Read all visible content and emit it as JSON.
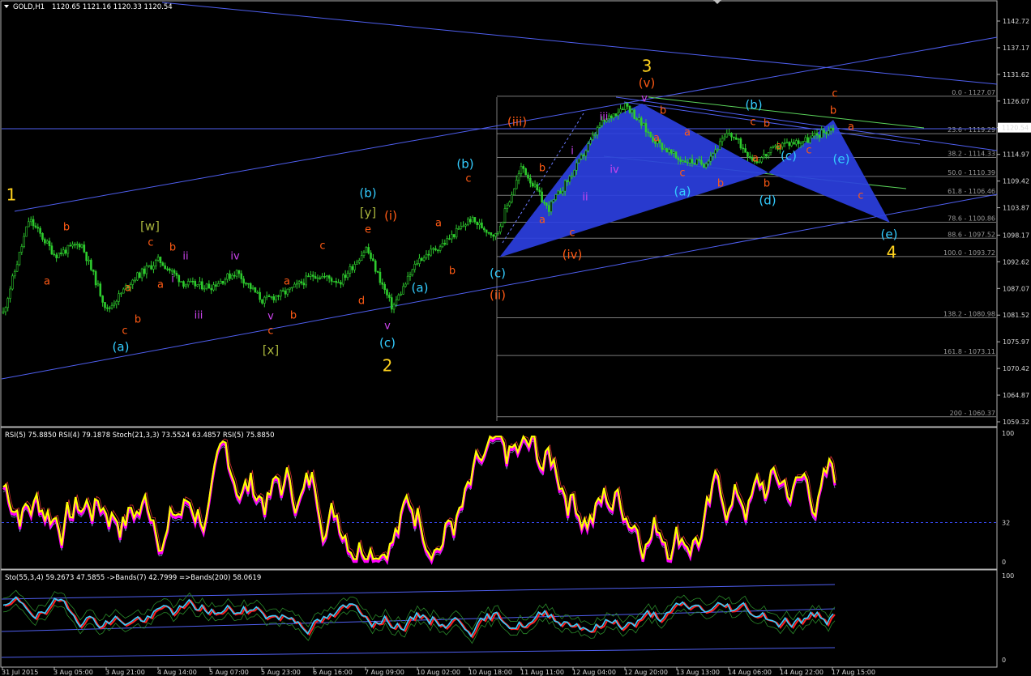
{
  "header": {
    "symbol": "GOLD,H1",
    "ohlc": "1120.65 1121.16 1120.33 1120.54",
    "rsi_header": "RSI(5) 75.8850  RSI(4) 79.1878  Stoch(21,3,3) 73.5524 63.4857  RSI(5) 75.8850",
    "sto_header": "Sto(55,3,4) 59.2673 47.5855  ->Bands(7) 42.7999  =>Bands(200) 58.0619"
  },
  "price_axis": {
    "ticks": [
      "1142.72",
      "1137.17",
      "1131.62",
      "1126.07",
      "1120.54",
      "1114.97",
      "1109.42",
      "1103.87",
      "1098.17",
      "1092.62",
      "1087.07",
      "1081.52",
      "1075.97",
      "1070.42",
      "1064.87",
      "1059.32"
    ],
    "current": "1120.54"
  },
  "rsi_axis": {
    "ticks": [
      "100",
      "32",
      "0"
    ]
  },
  "sto_axis": {
    "ticks": [
      "100",
      "0"
    ]
  },
  "time_axis": {
    "labels": [
      "31 Jul 2015",
      "3 Aug 05:00",
      "3 Aug 21:00",
      "4 Aug 14:00",
      "5 Aug 07:00",
      "5 Aug 23:00",
      "6 Aug 16:00",
      "7 Aug 09:00",
      "10 Aug 02:00",
      "10 Aug 18:00",
      "11 Aug 11:00",
      "12 Aug 04:00",
      "12 Aug 20:00",
      "13 Aug 13:00",
      "14 Aug 06:00",
      "14 Aug 22:00",
      "17 Aug 15:00"
    ]
  },
  "fib_levels": [
    {
      "label": "0.0 - 1127.07",
      "price": 1127.07
    },
    {
      "label": "23.6 - 1119.29",
      "price": 1119.29
    },
    {
      "label": "38.2 - 1114.33",
      "price": 1114.33
    },
    {
      "label": "50.0 - 1110.39",
      "price": 1110.39
    },
    {
      "label": "61.8 - 1106.46",
      "price": 1106.46
    },
    {
      "label": "78.6 - 1100.86",
      "price": 1100.86
    },
    {
      "label": "88.6 - 1097.52",
      "price": 1097.52
    },
    {
      "label": "100.0 - 1093.72",
      "price": 1093.72
    },
    {
      "label": "138.2 - 1080.98",
      "price": 1080.98
    },
    {
      "label": "161.8 - 1073.11",
      "price": 1073.11
    },
    {
      "label": "200 - 1060.37",
      "price": 1060.37
    }
  ],
  "colors": {
    "candles": "#2ecc2e",
    "trendline": "#4f5ff0",
    "wedge": "#2b3fe0",
    "green_line": "#5bd45b",
    "rsi_yellow": "#ffff00",
    "rsi_magenta": "#ff00ff",
    "orange": "#ff5a14",
    "cyan": "#33ccff",
    "magenta": "#cc44ee",
    "yellow": "#ffd21e",
    "olive": "#a8b43c",
    "brown": "#ff5a14"
  },
  "wave_labels": [
    {
      "text": "1",
      "color": "yellow",
      "size": "big"
    },
    {
      "text": "a",
      "color": "orange",
      "size": "small"
    },
    {
      "text": "b",
      "color": "orange",
      "size": "small"
    },
    {
      "text": "c",
      "color": "orange",
      "size": "small"
    },
    {
      "text": "(a)",
      "color": "cyan",
      "size": "mid"
    },
    {
      "text": "a",
      "color": "orange",
      "size": "small"
    },
    {
      "text": "b",
      "color": "orange",
      "size": "small"
    },
    {
      "text": "c",
      "color": "orange",
      "size": "small"
    },
    {
      "text": "[w]",
      "color": "olive",
      "size": "mid"
    },
    {
      "text": "a",
      "color": "orange",
      "size": "small"
    },
    {
      "text": "b",
      "color": "orange",
      "size": "small"
    },
    {
      "text": "i",
      "color": "magenta",
      "size": "small"
    },
    {
      "text": "ii",
      "color": "magenta",
      "size": "small"
    },
    {
      "text": "iii",
      "color": "magenta",
      "size": "small"
    },
    {
      "text": "iv",
      "color": "magenta",
      "size": "small"
    },
    {
      "text": "v",
      "color": "magenta",
      "size": "small"
    },
    {
      "text": "c",
      "color": "orange",
      "size": "small"
    },
    {
      "text": "[x]",
      "color": "olive",
      "size": "mid"
    },
    {
      "text": "a",
      "color": "orange",
      "size": "small"
    },
    {
      "text": "b",
      "color": "orange",
      "size": "small"
    },
    {
      "text": "c",
      "color": "orange",
      "size": "small"
    },
    {
      "text": "d",
      "color": "orange",
      "size": "small"
    },
    {
      "text": "e",
      "color": "orange",
      "size": "small"
    },
    {
      "text": "[y]",
      "color": "olive",
      "size": "mid"
    },
    {
      "text": "(b)",
      "color": "cyan",
      "size": "mid"
    },
    {
      "text": "(i)",
      "color": "brown",
      "size": "mid"
    },
    {
      "text": "v",
      "color": "magenta",
      "size": "small"
    },
    {
      "text": "(c)",
      "color": "cyan",
      "size": "mid"
    },
    {
      "text": "2",
      "color": "yellow",
      "size": "big"
    },
    {
      "text": "(a)",
      "color": "cyan",
      "size": "mid"
    },
    {
      "text": "b",
      "color": "orange",
      "size": "small"
    },
    {
      "text": "a",
      "color": "orange",
      "size": "small"
    },
    {
      "text": "c",
      "color": "orange",
      "size": "small"
    },
    {
      "text": "(b)",
      "color": "cyan",
      "size": "mid"
    },
    {
      "text": "(c)",
      "color": "cyan",
      "size": "mid"
    },
    {
      "text": "(ii)",
      "color": "brown",
      "size": "mid"
    },
    {
      "text": "(iii)",
      "color": "brown",
      "size": "mid"
    },
    {
      "text": "b",
      "color": "orange",
      "size": "small"
    },
    {
      "text": "a",
      "color": "orange",
      "size": "small"
    },
    {
      "text": "c",
      "color": "orange",
      "size": "small"
    },
    {
      "text": "(iv)",
      "color": "brown",
      "size": "mid"
    },
    {
      "text": "i",
      "color": "magenta",
      "size": "small"
    },
    {
      "text": "ii",
      "color": "magenta",
      "size": "small"
    },
    {
      "text": "iii",
      "color": "magenta",
      "size": "small"
    },
    {
      "text": "iv",
      "color": "magenta",
      "size": "small"
    },
    {
      "text": "v",
      "color": "magenta",
      "size": "small"
    },
    {
      "text": "3",
      "color": "yellow",
      "size": "big"
    },
    {
      "text": "(v)",
      "color": "brown",
      "size": "mid"
    },
    {
      "text": "b",
      "color": "orange",
      "size": "small"
    },
    {
      "text": "a",
      "color": "orange",
      "size": "small"
    },
    {
      "text": "a",
      "color": "orange",
      "size": "small"
    },
    {
      "text": "c",
      "color": "orange",
      "size": "small"
    },
    {
      "text": "b",
      "color": "orange",
      "size": "small"
    },
    {
      "text": "(a)",
      "color": "cyan",
      "size": "mid"
    },
    {
      "text": "(b)",
      "color": "cyan",
      "size": "mid"
    },
    {
      "text": "c",
      "color": "orange",
      "size": "small"
    },
    {
      "text": "b",
      "color": "orange",
      "size": "small"
    },
    {
      "text": "a",
      "color": "orange",
      "size": "small"
    },
    {
      "text": "a",
      "color": "orange",
      "size": "small"
    },
    {
      "text": "c",
      "color": "orange",
      "size": "small"
    },
    {
      "text": "b",
      "color": "orange",
      "size": "small"
    },
    {
      "text": "(c)",
      "color": "cyan",
      "size": "mid"
    },
    {
      "text": "(d)",
      "color": "cyan",
      "size": "mid"
    },
    {
      "text": "c",
      "color": "orange",
      "size": "small"
    },
    {
      "text": "b",
      "color": "orange",
      "size": "small"
    },
    {
      "text": "a",
      "color": "orange",
      "size": "small"
    },
    {
      "text": "(e)",
      "color": "cyan",
      "size": "mid"
    },
    {
      "text": "c",
      "color": "orange",
      "size": "small"
    },
    {
      "text": "(e)",
      "color": "cyan",
      "size": "mid"
    },
    {
      "text": "4",
      "color": "yellow",
      "size": "big"
    }
  ],
  "chart_data": {
    "type": "line",
    "title": "GOLD,H1",
    "price_range": [
      1059.32,
      1145.0
    ],
    "close_series": [
      {
        "x": "31 Jul 2015",
        "y": 1082.0
      },
      {
        "x": "31 Jul 2015",
        "y": 1101.5
      },
      {
        "x": "3 Aug 05:00",
        "y": 1094.0
      },
      {
        "x": "3 Aug 05:00",
        "y": 1096.5
      },
      {
        "x": "3 Aug 21:00",
        "y": 1082.5
      },
      {
        "x": "3 Aug 21:00",
        "y": 1089.0
      },
      {
        "x": "4 Aug 14:00",
        "y": 1093.0
      },
      {
        "x": "4 Aug 14:00",
        "y": 1088.0
      },
      {
        "x": "5 Aug 07:00",
        "y": 1087.5
      },
      {
        "x": "5 Aug 07:00",
        "y": 1090.5
      },
      {
        "x": "5 Aug 23:00",
        "y": 1084.5
      },
      {
        "x": "5 Aug 23:00",
        "y": 1086.5
      },
      {
        "x": "6 Aug 16:00",
        "y": 1090.0
      },
      {
        "x": "6 Aug 16:00",
        "y": 1088.5
      },
      {
        "x": "7 Aug 09:00",
        "y": 1095.5
      },
      {
        "x": "7 Aug 09:00",
        "y": 1083.0
      },
      {
        "x": "10 Aug 02:00",
        "y": 1093.0
      },
      {
        "x": "10 Aug 02:00",
        "y": 1096.5
      },
      {
        "x": "10 Aug 18:00",
        "y": 1101.5
      },
      {
        "x": "10 Aug 18:00",
        "y": 1098.0
      },
      {
        "x": "11 Aug 11:00",
        "y": 1112.5
      },
      {
        "x": "11 Aug 11:00",
        "y": 1103.5
      },
      {
        "x": "12 Aug 04:00",
        "y": 1111.5
      },
      {
        "x": "12 Aug 04:00",
        "y": 1121.0
      },
      {
        "x": "12 Aug 20:00",
        "y": 1125.5
      },
      {
        "x": "12 Aug 20:00",
        "y": 1118.5
      },
      {
        "x": "13 Aug 13:00",
        "y": 1114.0
      },
      {
        "x": "13 Aug 13:00",
        "y": 1113.0
      },
      {
        "x": "14 Aug 06:00",
        "y": 1119.5
      },
      {
        "x": "14 Aug 06:00",
        "y": 1113.5
      },
      {
        "x": "14 Aug 22:00",
        "y": 1117.0
      },
      {
        "x": "14 Aug 22:00",
        "y": 1118.0
      },
      {
        "x": "17 Aug 15:00",
        "y": 1120.54
      }
    ],
    "indicators": {
      "rsi_axis_ticks": [
        100,
        32,
        0
      ],
      "sto_axis_ticks": [
        100,
        0
      ]
    },
    "grid": false
  }
}
